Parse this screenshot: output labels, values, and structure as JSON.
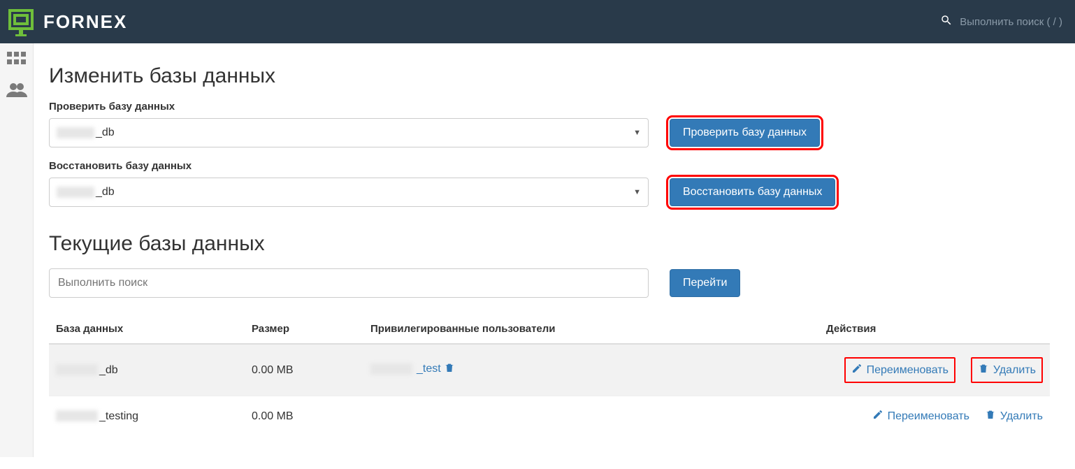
{
  "header": {
    "brand": "FORNEX",
    "search_placeholder": "Выполнить поиск ( / )"
  },
  "sections": {
    "edit_title": "Изменить базы данных",
    "check_label": "Проверить базу данных",
    "check_select": "_db",
    "check_button": "Проверить базу данных",
    "repair_label": "Восстановить базу данных",
    "repair_select": "_db",
    "repair_button": "Восстановить базу данных",
    "current_title": "Текущие базы данных",
    "search_placeholder": "Выполнить поиск",
    "go_button": "Перейти"
  },
  "table": {
    "headers": {
      "db": "База данных",
      "size": "Размер",
      "users": "Привилегированные пользователи",
      "actions": "Действия"
    },
    "rows": [
      {
        "name": "_db",
        "size": "0.00 MB",
        "user": "_test",
        "highlight": true
      },
      {
        "name": "_testing",
        "size": "0.00 MB",
        "user": "",
        "highlight": false
      }
    ],
    "rename": "Переименовать",
    "delete": "Удалить"
  }
}
